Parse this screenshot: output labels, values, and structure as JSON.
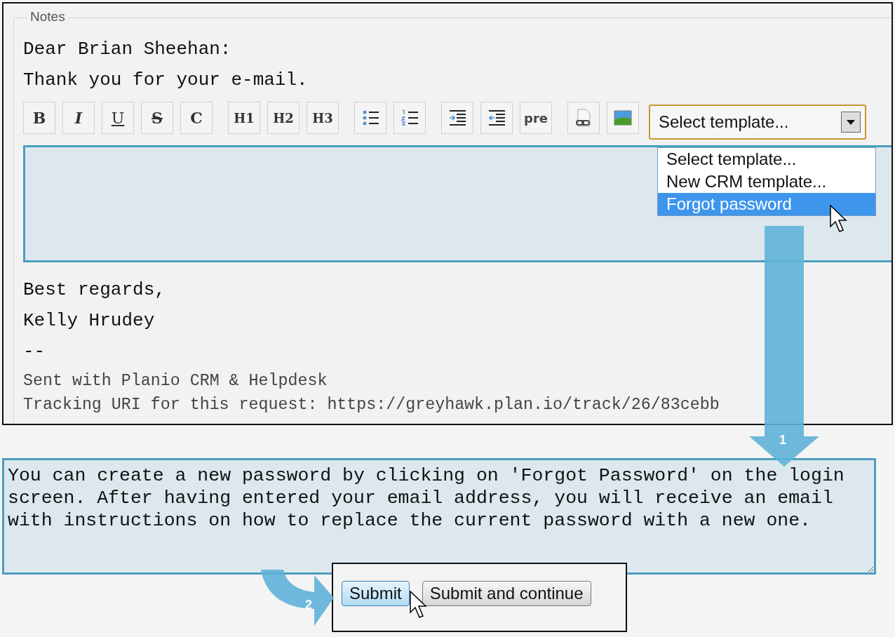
{
  "notes": {
    "legend": "Notes",
    "greeting": [
      "Dear Brian Sheehan:",
      "Thank you for your e-mail."
    ],
    "toolbar": [
      [
        {
          "kind": "bold",
          "label": "B"
        },
        {
          "kind": "italic",
          "label": "I"
        },
        {
          "kind": "underline",
          "label": "U"
        },
        {
          "kind": "strike",
          "label": "S"
        },
        {
          "kind": "code",
          "label": "C"
        }
      ],
      [
        {
          "kind": "heading",
          "label": "H1"
        },
        {
          "kind": "heading",
          "label": "H2"
        },
        {
          "kind": "heading",
          "label": "H3"
        }
      ],
      [
        {
          "kind": "bullets"
        },
        {
          "kind": "numbers"
        }
      ],
      [
        {
          "kind": "indent"
        },
        {
          "kind": "outdent"
        },
        {
          "kind": "pre",
          "label": "pre"
        }
      ],
      [
        {
          "kind": "link"
        },
        {
          "kind": "image"
        }
      ]
    ],
    "template_select": {
      "value": "Select template...",
      "expanded": true,
      "options": [
        {
          "label": "Select template...",
          "highlighted": false
        },
        {
          "label": "New CRM template...",
          "highlighted": false
        },
        {
          "label": "Forgot password",
          "highlighted": true
        }
      ]
    },
    "signature": [
      "Best regards,",
      "Kelly Hrudey",
      "--"
    ],
    "footer": [
      "Sent with Planio CRM & Helpdesk",
      "Tracking URI for this request: https://greyhawk.plan.io/track/26/83cebb"
    ]
  },
  "reply": {
    "value": "You can create a new password by clicking on 'Forgot Password' on the login screen. After having entered your email address, you will receive an email with instructions on how to replace the current password with a new one."
  },
  "steps": [
    "1",
    "2"
  ],
  "buttons": [
    {
      "label": "Submit",
      "focused": true
    },
    {
      "label": "Submit and continue",
      "focused": false
    }
  ]
}
